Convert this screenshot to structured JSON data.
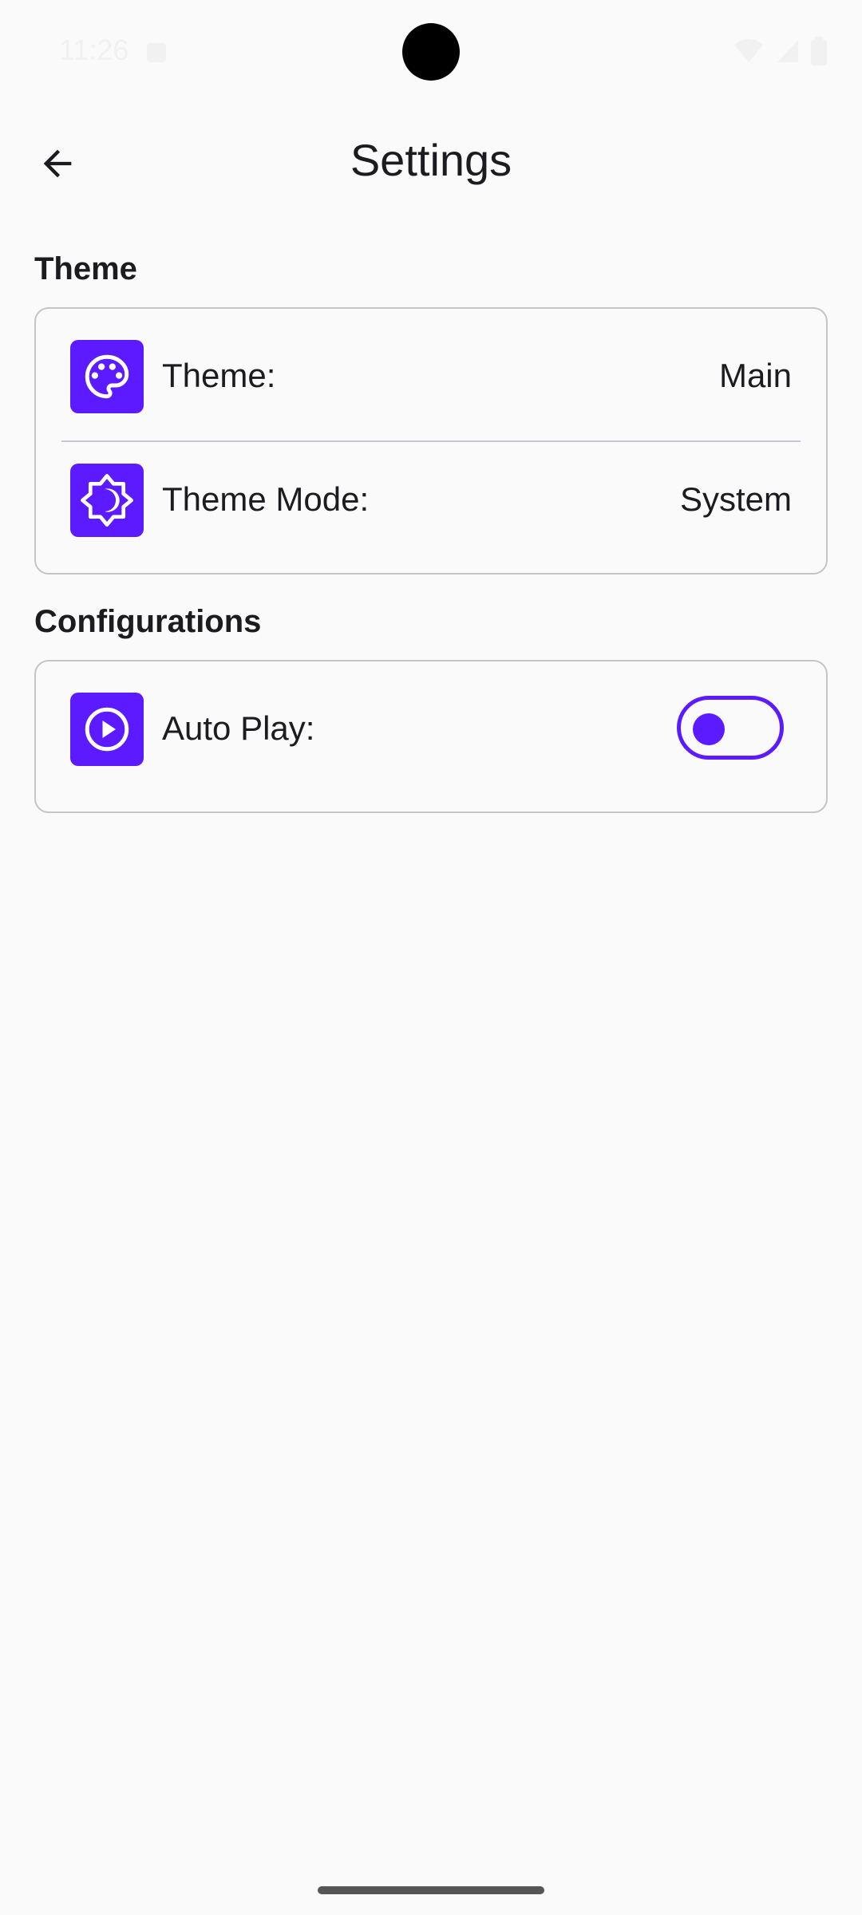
{
  "status_bar": {
    "time": "11:26"
  },
  "app_bar": {
    "title": "Settings",
    "back_icon": "arrow-back-icon"
  },
  "sections": [
    {
      "header": "Theme",
      "rows": [
        {
          "icon": "palette-icon",
          "label": "Theme:",
          "value": "Main"
        },
        {
          "icon": "brightness-auto-icon",
          "label": "Theme Mode:",
          "value": "System"
        }
      ]
    },
    {
      "header": "Configurations",
      "rows": [
        {
          "icon": "play-circle-icon",
          "label": "Auto Play:",
          "toggle_on": false
        }
      ]
    }
  ],
  "colors": {
    "accent": "#5b1aff",
    "background": "#fafafa",
    "card_border": "#c4c4c8",
    "text": "#1c1b1f"
  }
}
